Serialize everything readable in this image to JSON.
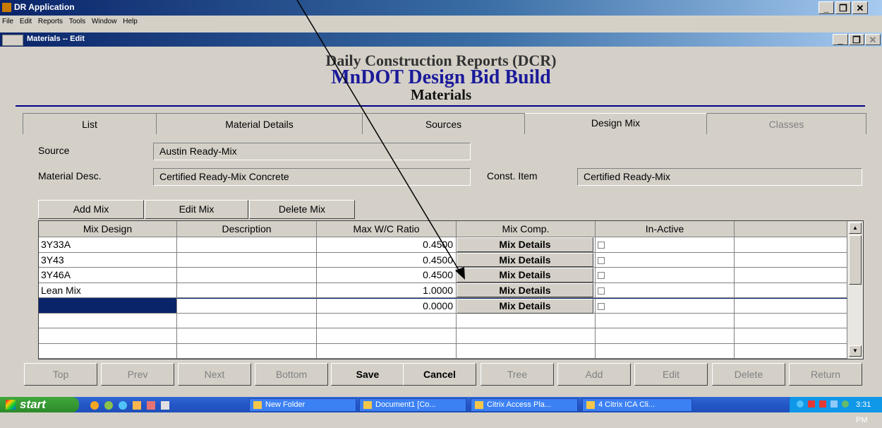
{
  "app": {
    "title": "DR Application"
  },
  "menu": [
    "File",
    "Edit",
    "Reports",
    "Tools",
    "Window",
    "Help"
  ],
  "child": {
    "title": "Materials -- Edit"
  },
  "header": {
    "line1": "Daily Construction Reports (DCR)",
    "line2": "MnDOT Design Bid Build",
    "line3": "Materials"
  },
  "tabs": [
    "List",
    "Material Details",
    "Sources",
    "Design Mix",
    "Classes"
  ],
  "form": {
    "source_label": "Source",
    "source_value": "Austin Ready-Mix",
    "desc_label": "Material Desc.",
    "desc_value": "Certified Ready-Mix Concrete",
    "item_label": "Const. Item",
    "item_value": "Certified Ready-Mix"
  },
  "mix_buttons": {
    "add": "Add Mix",
    "edit": "Edit Mix",
    "delete": "Delete Mix"
  },
  "grid": {
    "headers": [
      "Mix Design",
      "Description",
      "Max W/C Ratio",
      "Mix Comp.",
      "In-Active",
      ""
    ],
    "rows": [
      {
        "mix": "3Y33A",
        "desc": "",
        "ratio": "0.4500",
        "comp": "Mix Details"
      },
      {
        "mix": "3Y43",
        "desc": "",
        "ratio": "0.4500",
        "comp": "Mix Details"
      },
      {
        "mix": "3Y46A",
        "desc": "",
        "ratio": "0.4500",
        "comp": "Mix Details"
      },
      {
        "mix": "Lean Mix",
        "desc": "",
        "ratio": "1.0000",
        "comp": "Mix Details"
      },
      {
        "mix": "",
        "desc": "",
        "ratio": "0.0000",
        "comp": "Mix Details"
      }
    ]
  },
  "nav": [
    "Top",
    "Prev",
    "Next",
    "Bottom",
    "Save",
    "Cancel",
    "Tree",
    "Add",
    "Edit",
    "Delete",
    "Return"
  ],
  "taskbar": {
    "start": "start",
    "tasks": [
      "New Folder",
      "Document1 [Co...",
      "Citrix Access Pla...",
      "4 Citrix ICA Cli..."
    ],
    "clock": "3:31 PM"
  },
  "colors": {
    "title_blue": "#0a246a",
    "header_blue": "#1a1a9a",
    "selected_row": "#0a246a"
  }
}
